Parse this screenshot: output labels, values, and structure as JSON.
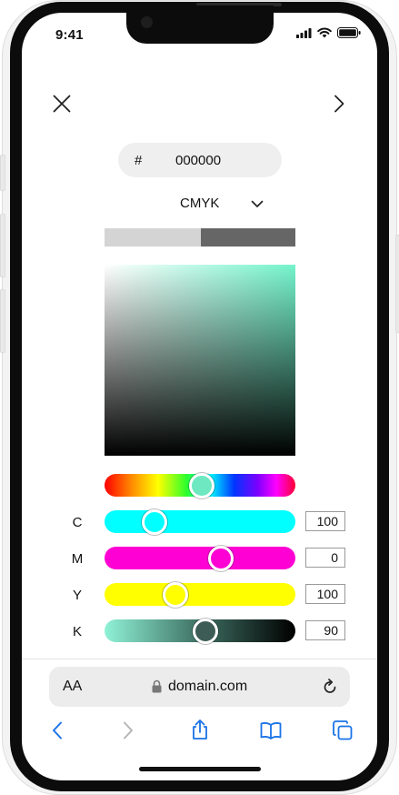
{
  "status_bar": {
    "time": "9:41"
  },
  "color_picker": {
    "hex_prefix": "#",
    "hex_value": "000000",
    "mode": "CMYK",
    "current_color": "#d4d4d4",
    "new_color": "#666666",
    "sv_hue_color": "#74f3cb",
    "hue": 0.51,
    "channels": [
      {
        "label": "C",
        "value": "100",
        "level": 0.26,
        "knob_color": "#00ffff"
      },
      {
        "label": "M",
        "value": "0",
        "level": 0.61,
        "knob_color": "#ff00d4"
      },
      {
        "label": "Y",
        "value": "100",
        "level": 0.37,
        "knob_color": "#ffff00"
      },
      {
        "label": "K",
        "value": "90",
        "level": 0.53,
        "knob_color": "#3d5c55"
      }
    ]
  },
  "browser": {
    "text_size": "AA",
    "url": "domain.com"
  },
  "colors": {
    "accent": "#1a73e8",
    "disabled": "#b5b5b5"
  }
}
